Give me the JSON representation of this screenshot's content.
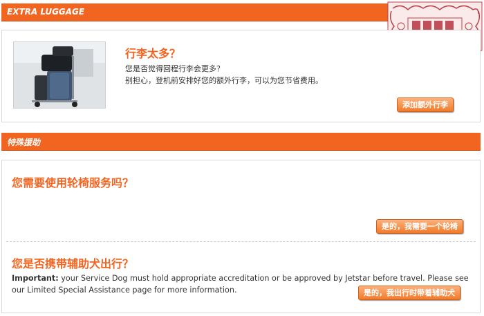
{
  "extra_luggage": {
    "header": "EXTRA LUGGAGE",
    "title": "行李太多？",
    "line1": "您是否觉得回程行李会更多？",
    "line2": "别担心，登机前安排好您的额外行李，可以为您节省费用。",
    "button": "添加额外行李"
  },
  "special_assistance": {
    "header": "特殊援助",
    "wheelchair_title": "您需要使用轮椅服务吗？",
    "wheelchair_button": "是的，我需要一个轮椅",
    "dog_title": "您是否携带辅助犬出行？",
    "dog_important": "Important:",
    "dog_text": " your Service Dog must hold appropriate accreditation or be approved by Jetstar before travel. Please see our Limited Special Assistance page for more information.",
    "dog_button": "是的，我出行时带着辅助犬"
  },
  "colors": {
    "accent": "#f26521",
    "button": "#f27a2b"
  },
  "icons": {
    "luggage_photo": "luggage-cart-photo",
    "stamp": "red-seal-stamp"
  }
}
